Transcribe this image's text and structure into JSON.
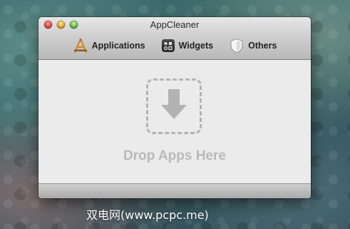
{
  "window": {
    "title": "AppCleaner"
  },
  "toolbar": {
    "items": [
      {
        "label": "Applications",
        "icon": "applications-icon"
      },
      {
        "label": "Widgets",
        "icon": "widgets-icon"
      },
      {
        "label": "Others",
        "icon": "others-icon"
      }
    ]
  },
  "dropzone": {
    "label": "Drop Apps Here",
    "icon": "download-arrow-icon"
  },
  "watermark": {
    "text": "双电网(www.pcpc.me)"
  },
  "colors": {
    "window_bg": "#ebebeb",
    "drop_hint": "#b9b9b9",
    "close": "#d7382b",
    "minimize": "#d89a14",
    "zoom": "#4fae2c"
  }
}
